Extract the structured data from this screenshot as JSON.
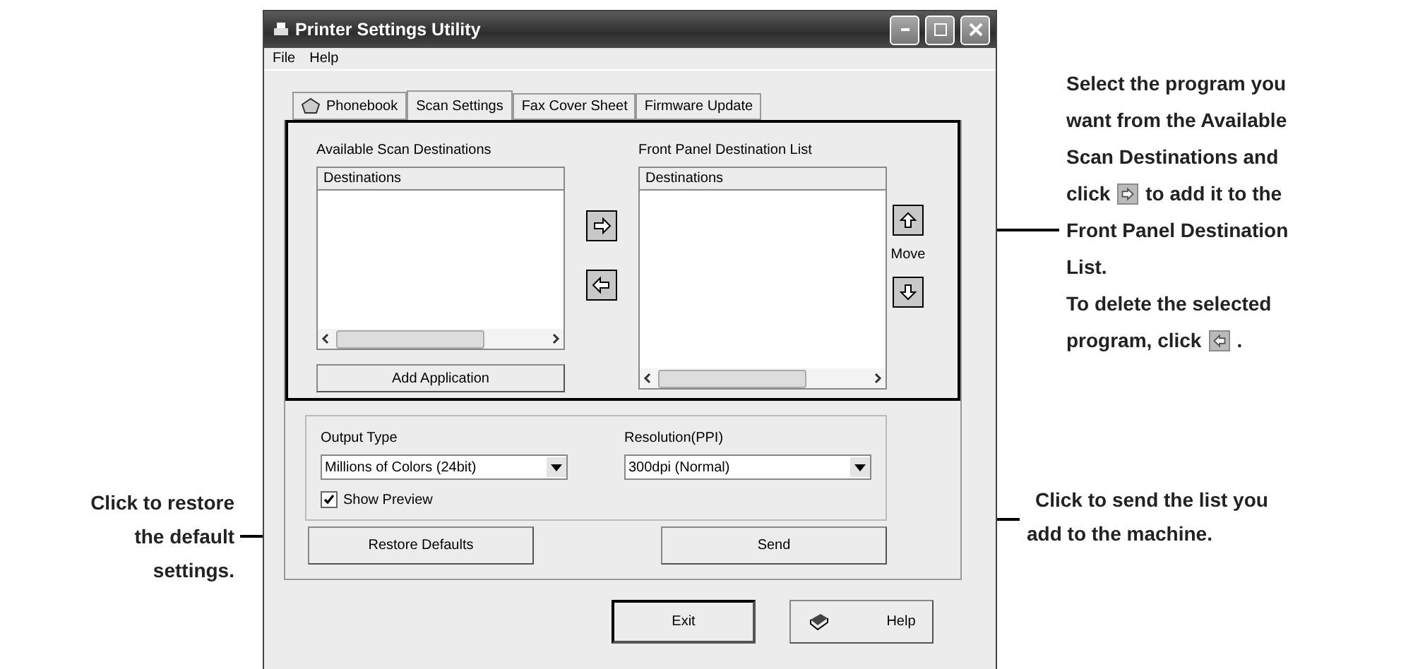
{
  "window": {
    "title": "Printer Settings Utility",
    "menu": [
      "File",
      "Help"
    ],
    "tabs": [
      {
        "label": "Phonebook",
        "selected": false,
        "kind": "icon"
      },
      {
        "label": "Scan Settings",
        "selected": true,
        "kind": "plain"
      },
      {
        "label": "Fax Cover Sheet",
        "selected": false,
        "kind": "plain"
      },
      {
        "label": "Firmware Update",
        "selected": false,
        "kind": "plain"
      }
    ],
    "available": {
      "label": "Available Scan Destinations",
      "header": "Destinations",
      "button": "Add Application"
    },
    "front_panel": {
      "label": "Front Panel Destination List",
      "header": "Destinations",
      "move_label": "Move"
    },
    "output_type": {
      "label": "Output Type",
      "value": "Millions of Colors (24bit)"
    },
    "resolution": {
      "label": "Resolution(PPI)",
      "value": "300dpi (Normal)"
    },
    "show_preview": {
      "label": "Show Preview",
      "checked": true
    },
    "restore_button": "Restore Defaults",
    "send_button": "Send",
    "exit_button": "Exit",
    "help_button": "Help"
  },
  "callouts": {
    "panel": [
      [
        {
          "kind": "text",
          "text": "Select the program you"
        }
      ],
      [
        {
          "kind": "text",
          "text": "want from the Available"
        }
      ],
      [
        {
          "kind": "text",
          "text": "Scan Destinations and"
        }
      ],
      [
        {
          "kind": "text",
          "text": "click"
        },
        {
          "kind": "add-icon"
        },
        {
          "kind": "text",
          "text": "to add it to the"
        }
      ],
      [
        {
          "kind": "text",
          "text": "Front Panel Destination"
        }
      ],
      [
        {
          "kind": "text",
          "text": "List."
        }
      ],
      [
        {
          "kind": "text",
          "text": "To delete the selected"
        }
      ],
      [
        {
          "kind": "text",
          "text": "program, click"
        },
        {
          "kind": "remove-icon"
        },
        {
          "kind": "text",
          "text": "."
        }
      ]
    ],
    "restore": [
      "Click to restore",
      "the default",
      "settings."
    ],
    "send": [
      "Click to send the list you",
      "add to the machine."
    ]
  }
}
